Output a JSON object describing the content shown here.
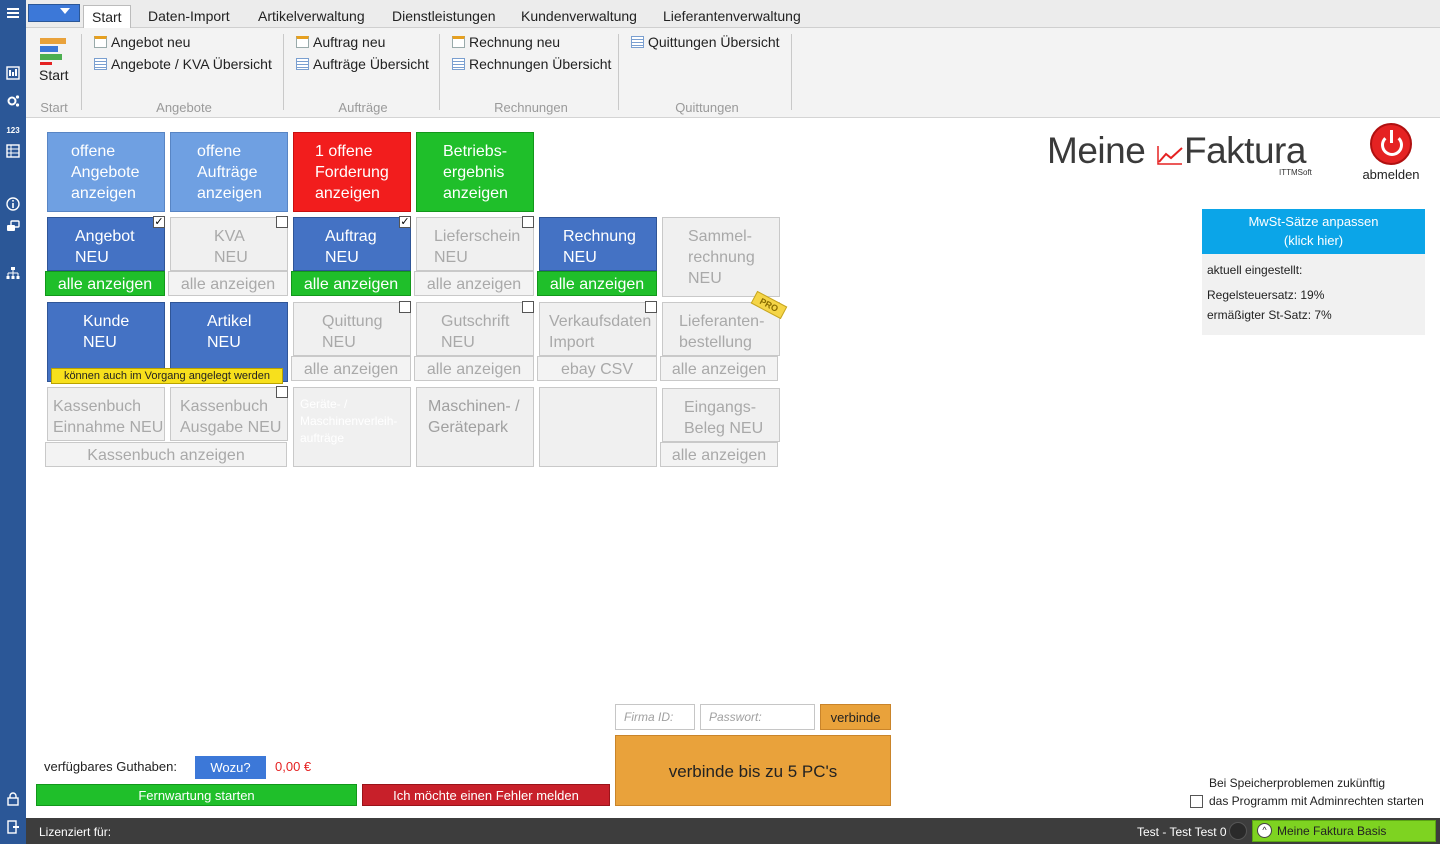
{
  "tabs": [
    "Start",
    "Daten-Import",
    "Artikelverwaltung",
    "Dienstleistungen",
    "Kundenverwaltung",
    "Lieferantenverwaltung"
  ],
  "ribbon": {
    "start_label": "Start",
    "groups": [
      "Start",
      "Angebote",
      "Aufträge",
      "Rechnungen",
      "Quittungen"
    ],
    "items": {
      "angebot_neu": "Angebot neu",
      "angebote_uebersicht": "Angebote / KVA Übersicht",
      "auftrag_neu": "Auftrag neu",
      "auftraege_uebersicht": "Aufträge Übersicht",
      "rechnung_neu": "Rechnung neu",
      "rechnungen_uebersicht": "Rechnungen Übersicht",
      "quittungen_uebersicht": "Quittungen Übersicht"
    }
  },
  "tiles": {
    "offene_angebote": [
      "offene",
      "Angebote",
      "anzeigen"
    ],
    "offene_auftraege": [
      "offene",
      "Aufträge",
      "anzeigen"
    ],
    "offene_forderung": [
      "1 offene",
      "Forderung",
      "anzeigen"
    ],
    "betriebsergebnis": [
      "Betriebs-",
      "ergebnis",
      "anzeigen"
    ],
    "angebot_neu": [
      "Angebot",
      "NEU"
    ],
    "kva_neu": [
      "KVA",
      "NEU"
    ],
    "auftrag_neu": [
      "Auftrag",
      "NEU"
    ],
    "lieferschein_neu": [
      "Lieferschein",
      "NEU"
    ],
    "rechnung_neu": [
      "Rechnung",
      "NEU"
    ],
    "sammelrechnung_neu": [
      "Sammel-",
      "rechnung",
      "NEU"
    ],
    "kunde_neu": [
      "Kunde",
      "NEU"
    ],
    "artikel_neu": [
      "Artikel",
      "NEU"
    ],
    "quittung_neu": [
      "Quittung",
      "NEU"
    ],
    "gutschrift_neu": [
      "Gutschrift",
      "NEU"
    ],
    "verkaufsdaten_import": [
      "Verkaufsdaten",
      "Import"
    ],
    "lieferantenbestellung": [
      "Lieferanten-",
      "bestellung"
    ],
    "kassenbuch_einnahme": [
      "Kassenbuch",
      "Einnahme NEU"
    ],
    "kassenbuch_ausgabe": [
      "Kassenbuch",
      "Ausgabe NEU"
    ],
    "geraeteverleih": [
      "Geräte- /",
      "Maschinenverleih-",
      "aufträge"
    ],
    "maschinen_geraetepark": [
      "Maschinen- /",
      "Gerätepark"
    ],
    "eingangsbeleg_neu": [
      "Eingangs-",
      "Beleg NEU"
    ]
  },
  "bars": {
    "alle_anzeigen": "alle anzeigen",
    "ebay_csv": "ebay CSV",
    "kassenbuch_anzeigen": "Kassenbuch anzeigen"
  },
  "hint_vorgang": "können auch im Vorgang angelegt werden",
  "pro_badge": "PRO",
  "logo": {
    "left": "Meine",
    "right": "Faktura",
    "sub": "ITTMSoft"
  },
  "abmelden": "abmelden",
  "mwst": {
    "button": [
      "MwSt-Sätze anpassen",
      "(klick hier)"
    ],
    "current": "aktuell eingestellt:",
    "regel": "Regelsteuersatz: 19%",
    "ermaessigt": "ermäßigter St-Satz: 7%"
  },
  "guthaben": {
    "label": "verfügbares Guthaben:",
    "wozu": "Wozu?",
    "value": "0,00 €"
  },
  "fernwartung": "Fernwartung starten",
  "fehler_melden": "Ich möchte einen Fehler melden",
  "connect": {
    "firma_placeholder": "Firma ID:",
    "passwort_placeholder": "Passwort:",
    "verbinde": "verbinde",
    "multi_pc": "verbinde bis zu 5 PC's"
  },
  "admin_hint": [
    "Bei Speicherproblemen zukünftig",
    "das Programm mit Adminrechten starten"
  ],
  "status": {
    "lizenziert": "Lizenziert für:",
    "user": "Test - Test Test 0",
    "edition": "Meine Faktura Basis"
  },
  "sidebar_label_123": "123",
  "colors": {
    "sidebar": "#2b5797",
    "tile_blue": "#4472c4",
    "tile_blue_light": "#6fa0e2",
    "red": "#f21d1d",
    "green": "#1fbf2a",
    "orange": "#e9a23b",
    "mwst_blue": "#0ba5e8"
  }
}
